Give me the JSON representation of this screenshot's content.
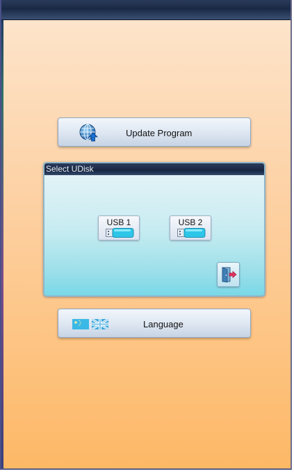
{
  "update_button": {
    "label": "Update Program",
    "icon": "globe-download-icon"
  },
  "dialog": {
    "title": "Select UDisk",
    "usb_buttons": [
      {
        "label": "USB 1",
        "icon": "usb-drive-icon"
      },
      {
        "label": "USB 2",
        "icon": "usb-drive-icon"
      }
    ],
    "exit_icon": "exit-door-icon"
  },
  "language_button": {
    "label": "Language",
    "flags": [
      "chinese-flag-icon",
      "uk-flag-icon"
    ]
  },
  "colors": {
    "background_top": "#fde6cf",
    "background_bottom": "#fdb866",
    "title_bar": "#1a2a45",
    "dialog_bottom": "#7ad8e7",
    "usb_drive": "#2ec6e8"
  }
}
